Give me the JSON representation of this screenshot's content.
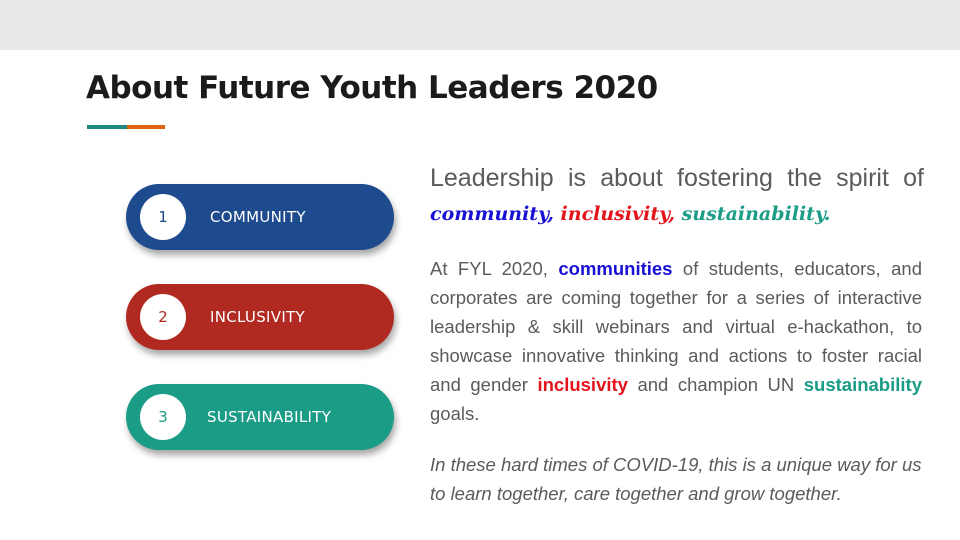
{
  "slide": {
    "title": "About Future Youth Leaders 2020",
    "colors": {
      "accent_teal": "#1e8a80",
      "accent_orange": "#e0620d"
    }
  },
  "pills": [
    {
      "number": "1",
      "label": "COMMUNITY",
      "color": "#1e4a8e"
    },
    {
      "number": "2",
      "label": "INCLUSIVITY",
      "color": "#b02a22"
    },
    {
      "number": "3",
      "label": "SUSTAINABILITY",
      "color": "#1b9c86"
    }
  ],
  "lead": {
    "text": "Leadership is about fostering the spirit of",
    "script_words": [
      "community,",
      "inclusivity,",
      "sustainability."
    ]
  },
  "body": {
    "part1": "At FYL 2020, ",
    "hl_communities": "communities",
    "part2": " of students, educators, and corporates are coming together for a series of interactive leadership & skill webinars and virtual e-hackathon, to showcase innovative thinking and actions to foster racial and gender ",
    "hl_inclusivity": "inclusivity",
    "part3": " and champion UN ",
    "hl_sustainability": "sustainability",
    "part4": " goals."
  },
  "quote": "In these hard times of COVID-19, this is a unique way for us to learn together, care together and grow together."
}
